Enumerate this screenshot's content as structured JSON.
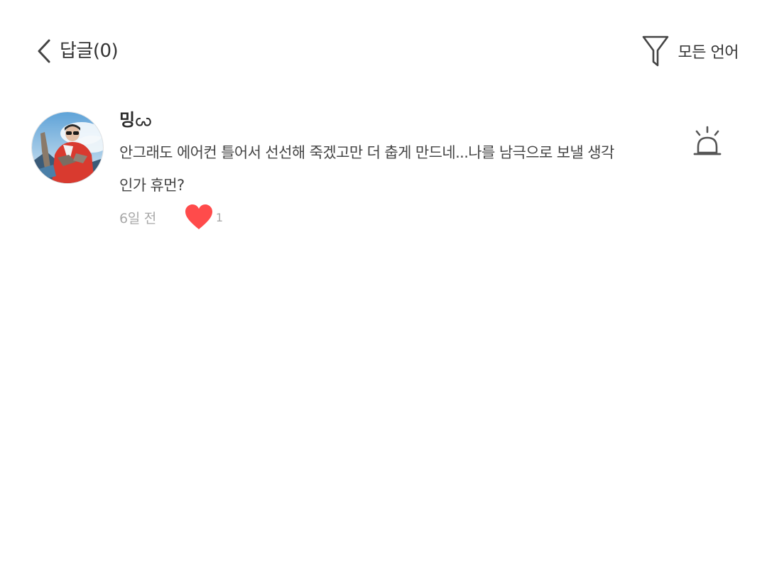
{
  "header": {
    "title": "답글(0)",
    "back_icon": "chevron-left-icon",
    "filter_icon": "funnel-icon",
    "filter_label": "모든 언어"
  },
  "comment": {
    "username": "밍ꩬ",
    "text": "안그래도 에어컨 틀어서 선선해 죽겠고만 더 춥게 만드네...나를 남극으로 보낼 생각인가 휴먼?",
    "timestamp": "6일 전",
    "like_count": "1",
    "like_icon": "heart-icon",
    "report_icon": "siren-icon",
    "avatar_icon": "avatar"
  },
  "colors": {
    "text": "#333333",
    "meta": "#a8a8a8",
    "heart": "#ff4b4b",
    "icon": "#555555"
  }
}
